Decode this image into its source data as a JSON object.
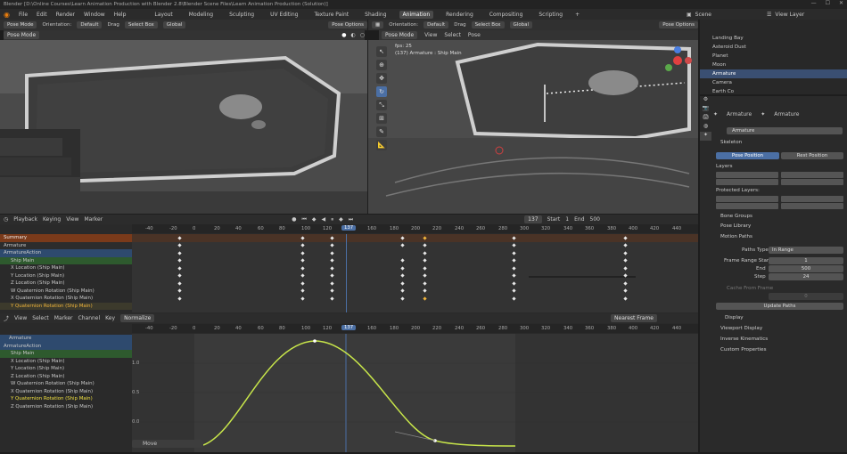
{
  "title": "Blender [D:\\Online Courses\\Learn Animation Production with Blender 2.8\\Blender Scene Files\\Learn Animation Production (Solution)]",
  "menu": [
    "File",
    "Edit",
    "Render",
    "Window",
    "Help"
  ],
  "workspaces": [
    "Layout",
    "Modeling",
    "Sculpting",
    "UV Editing",
    "Texture Paint",
    "Shading",
    "Animation",
    "Rendering",
    "Compositing",
    "Scripting"
  ],
  "active_workspace": "Animation",
  "scene": {
    "icon": "scene-icon",
    "label": "Scene",
    "layer": "View Layer"
  },
  "left_view": {
    "mode": "Pose Mode",
    "orientation_label": "Orientation:",
    "orientation": "Default",
    "drag": "Drag",
    "select": "Select Box",
    "transform": "Global"
  },
  "right_view": {
    "mode": "Pose Mode",
    "view": "View",
    "select": "Select",
    "pose": "Pose",
    "orientation_label": "Orientation:",
    "orientation": "Default",
    "drag": "Drag",
    "select_box": "Select Box",
    "transform": "Global",
    "options": "Pose Options",
    "fps": "fps: 25",
    "object": "(137) Armature : Ship Main"
  },
  "left_options": "Pose Options",
  "playback": {
    "playback": "Playback",
    "keying": "Keying",
    "view": "View",
    "marker": "Marker",
    "frame": "137",
    "start_label": "Start",
    "start": "1",
    "end_label": "End",
    "end": "500"
  },
  "dopesheet": {
    "channels": [
      "Summary",
      "Armature",
      "ArmatureAction",
      "Ship Main",
      "X Location (Ship Main)",
      "Y Location (Ship Main)",
      "Z Location (Ship Main)",
      "W Quaternion Rotation (Ship Main)",
      "X Quaternion Rotation (Ship Main)",
      "Y Quaternion Rotation (Ship Main)"
    ],
    "ticks": [
      "-40",
      "-20",
      "0",
      "20",
      "40",
      "60",
      "80",
      "100",
      "120",
      "137",
      "160",
      "180",
      "200",
      "220",
      "240",
      "260",
      "280",
      "300",
      "320",
      "340",
      "360",
      "380",
      "400",
      "420",
      "440"
    ]
  },
  "graph": {
    "menu": [
      "View",
      "Select",
      "Marker",
      "Channel",
      "Key"
    ],
    "mode": "Normalize",
    "pivot": "Nearest Frame",
    "channels": [
      "Armature",
      "ArmatureAction",
      "Ship Main",
      "X Location (Ship Main)",
      "Y Location (Ship Main)",
      "Z Location (Ship Main)",
      "W Quaternion Rotation (Ship Main)",
      "X Quaternion Rotation (Ship Main)",
      "Y Quaternion Rotation (Ship Main)",
      "Z Quaternion Rotation (Ship Main)"
    ],
    "ticks": [
      "-40",
      "-20",
      "0",
      "20",
      "40",
      "60",
      "80",
      "100",
      "120",
      "137",
      "160",
      "180",
      "200",
      "220",
      "240",
      "260",
      "280",
      "300",
      "320",
      "340",
      "360",
      "380",
      "400",
      "420",
      "440"
    ],
    "yticks": [
      "1.0",
      "0.5",
      "0.0"
    ],
    "status": "Move"
  },
  "outliner": {
    "items": [
      "Landing Bay",
      "Asteroid Dust",
      "Planet",
      "Moon",
      "Armature",
      "Camera",
      "Earth Co"
    ]
  },
  "properties": {
    "tabs": [
      "Armature",
      "Armature"
    ],
    "name": "Armature",
    "sections": {
      "generation": "Skeleton",
      "pose_position": "Pose Position",
      "rest_position": "Rest Position",
      "layers": "Layers",
      "protected_layers": "Protected Layers:",
      "bone_groups": "Bone Groups",
      "pose_library": "Pose Library",
      "motion_paths": "Motion Paths",
      "paths_type_label": "Paths Type",
      "paths_type": "In Range",
      "range_start_label": "Frame Range Start",
      "range_start": "1",
      "end_label": "End",
      "end": "500",
      "step_label": "Step",
      "step": "24",
      "cache_label": "Cache From Frame",
      "cache": "0",
      "update_paths": "Update Paths",
      "display": "Display",
      "viewport_display": "Viewport Display",
      "inverse_kinematics": "Inverse Kinematics",
      "custom_properties": "Custom Properties"
    }
  }
}
